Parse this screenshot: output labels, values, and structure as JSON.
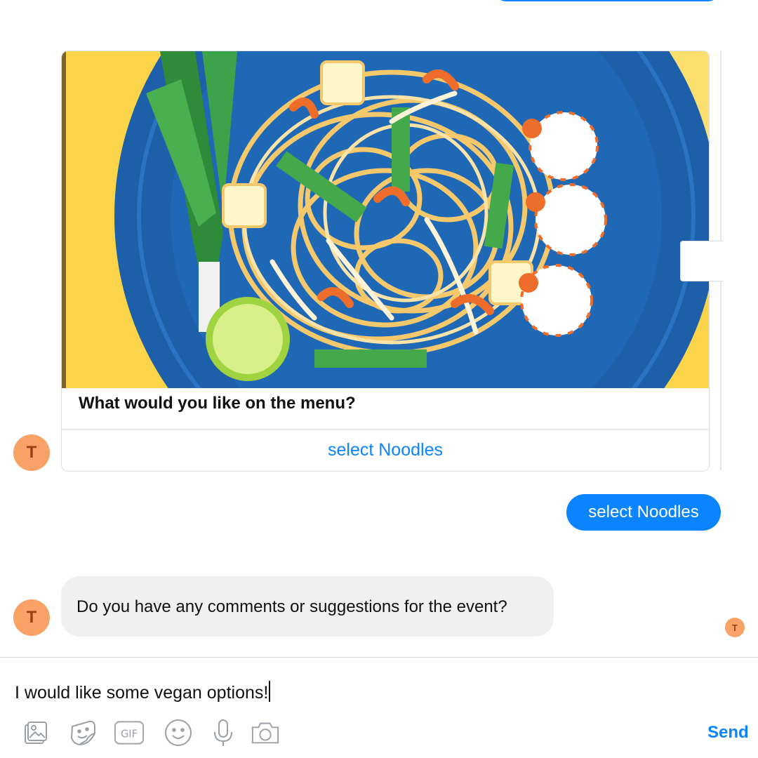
{
  "card": {
    "title": "What would you like on the menu?",
    "button_label": "select Noodles",
    "image": "noodle-dish-illustration"
  },
  "bot": {
    "avatar_letter": "T"
  },
  "messages": {
    "user_reply": "select Noodles",
    "bot_question": "Do you have any comments or suggestions for the event?"
  },
  "read_receipt": {
    "letter": "T"
  },
  "composer": {
    "input_value": "I would like some vegan options!",
    "send_label": "Send",
    "tools": [
      "photo-icon",
      "sticker-icon",
      "gif-icon",
      "emoji-icon",
      "microphone-icon",
      "camera-icon"
    ],
    "gif_text": "GIF"
  },
  "colors": {
    "accent": "#0a84ff",
    "avatar": "#f9a268",
    "bot_bubble": "#f0f0f0",
    "plate": "#1d5fa8",
    "background_yellow": "#fcd44a"
  }
}
